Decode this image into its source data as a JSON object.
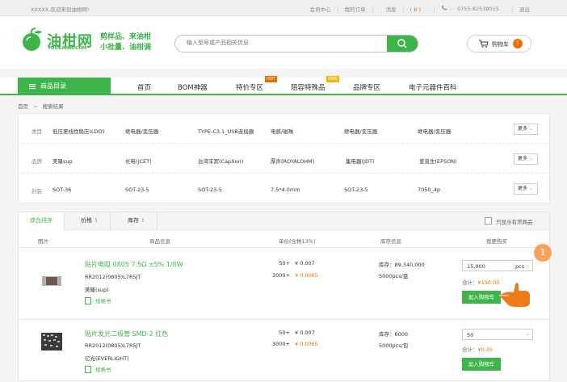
{
  "topbar": {
    "welcome": "XXXXX,欢迎来到油柑网!",
    "links": [
      "会员中心",
      "我的订单"
    ],
    "messages_label": "消息",
    "messages_count": "( 6 )",
    "hotline": "0755-82538015",
    "logout": "退出"
  },
  "header": {
    "logo_text": "油柑网",
    "logo_sub": "YOUGANW.COM",
    "slogan_1": "剪样品、来油柑",
    "slogan_2": "小批量、油柑调",
    "search_placeholder": "输入型号或产品相关信息",
    "cart_label": "购物车",
    "cart_count": "1"
  },
  "nav": {
    "category": "商品目录",
    "items": [
      "首页",
      "BOM神器",
      "特价专区",
      "阻容特殊品",
      "品牌专区",
      "电子元器件百科"
    ],
    "hot_tag": "HOT",
    "new_tag": "NEW"
  },
  "breadcrumb": {
    "home": "首页",
    "sep": ">",
    "current": "搜索结果"
  },
  "filters": [
    {
      "label": "类目",
      "options": [
        "低压差线性稳压(LDO)",
        "继电器/变压器",
        "TYPE-C3.1_USB连接器",
        "电感/磁珠",
        "继电器/变压器",
        "继电器/变压器"
      ],
      "more": "更多"
    },
    {
      "label": "品牌",
      "options": [
        "美隆sup",
        "长电(JCET)",
        "台湾丰宾(CapXon)",
        "厚声(ROYALOHM)",
        "集电器(JDT)",
        "爱普生(EPSON)"
      ],
      "more": "更多"
    },
    {
      "label": "封装",
      "options": [
        "SOT-36",
        "SOT-23-5",
        "SOT-23-5",
        "7.5*4.0mm",
        "SOT-23-5",
        "7050_4p"
      ],
      "more": "更多"
    }
  ],
  "sortbar": {
    "sorts": [
      "综合排序",
      "价格",
      "库存"
    ],
    "in_stock_only": "只显示有货商品"
  },
  "table_headers": [
    "图片",
    "商品信息",
    "单价(含税13％)",
    "库存信息",
    "我要购买"
  ],
  "products": [
    {
      "name": "贴片电阻 0805 7.5Ω ±5% 1/8W",
      "model": "RR2012(0805)L7R5JT",
      "brand": "美隆(sup)",
      "spec": "规格书",
      "tiers": [
        {
          "qty": "50+",
          "price": "¥ 0.007"
        },
        {
          "qty": "3000+",
          "price": "¥ 0.0065"
        }
      ],
      "stock_label": "库存：",
      "stock": "89,340,000",
      "pack": "5000pcs/盘",
      "quantity": "15,000",
      "unit": "pcs",
      "total_label": "合计：",
      "total": "¥150.00",
      "add_button": "加入购物车"
    },
    {
      "name": "贴片发光二极管 SMD-2 红色",
      "model": "RR2012(0805)L7R5JT",
      "brand": "亿光(EVERLIGHT)",
      "spec": "规格书",
      "tiers": [
        {
          "qty": "50+",
          "price": "¥ 0.007"
        },
        {
          "qty": "3000+",
          "price": "¥ 0.0065"
        }
      ],
      "stock_label": "库存：",
      "stock": "6000",
      "pack": "5000pcs/包",
      "quantity": "50",
      "unit": "",
      "total_label": "合计：",
      "total": "¥0.35",
      "add_button": "加入购物车"
    }
  ],
  "step_marker": "1",
  "colors": {
    "brand_green": "#3db54a",
    "accent_orange": "#f06c00"
  }
}
